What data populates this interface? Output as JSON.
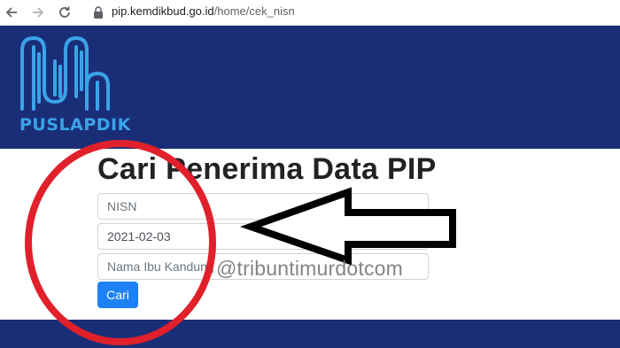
{
  "browser": {
    "url_host": "pip.kemdikbud.go.id",
    "url_path": "/home/cek_nisn"
  },
  "header": {
    "logo_text": "PUSLAPDIK",
    "colors": {
      "banner": "#1a2e78",
      "logo": "#3aa3e8"
    }
  },
  "main": {
    "title": "Cari Penerima Data PIP",
    "nisn_placeholder": "NISN",
    "dob_value": "2021-02-03",
    "mother_name_placeholder": "Nama Ibu Kandung",
    "search_button_label": "Cari",
    "colors": {
      "button": "#1d82f5"
    }
  },
  "overlay": {
    "watermark": "@tribuntimurdotcom",
    "circle_color": "#e0202a",
    "arrow_color": "#000000"
  }
}
